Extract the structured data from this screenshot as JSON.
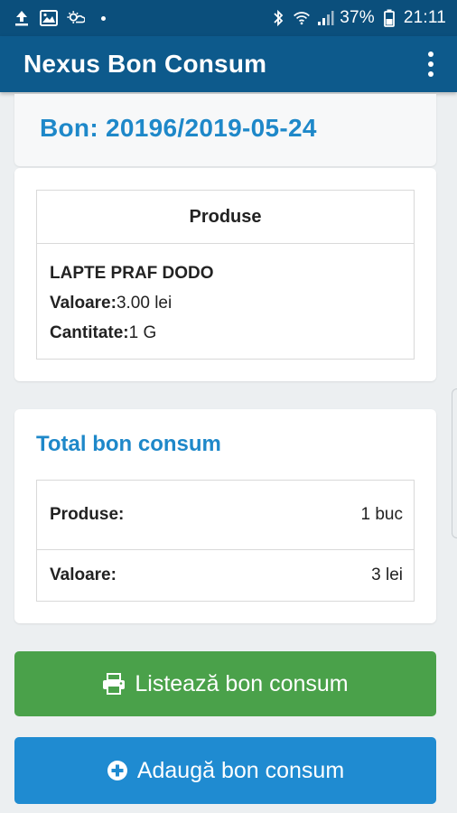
{
  "status_bar": {
    "battery": "37%",
    "time": "21:11"
  },
  "app_bar": {
    "title": "Nexus Bon Consum"
  },
  "receipt": {
    "title": "Bon: 20196/2019-05-24"
  },
  "products_table": {
    "header": "Produse",
    "items": [
      {
        "name": "LAPTE PRAF DODO",
        "value_label": "Valoare:",
        "value": "3.00 lei",
        "quantity_label": "Cantitate:",
        "quantity": "1 G"
      }
    ]
  },
  "total": {
    "title": "Total bon consum",
    "rows": [
      {
        "label": "Produse:",
        "value": "1 buc"
      },
      {
        "label": "Valoare:",
        "value": "3 lei"
      }
    ]
  },
  "actions": {
    "print_label": "Listează bon consum",
    "print_icon": "printer-icon",
    "add_label": "Adaugă bon consum",
    "add_icon": "plus-circle-icon"
  },
  "colors": {
    "status_bar": "#0b4f7c",
    "app_bar": "#0d5a8c",
    "accent_title": "#1e88c9",
    "print_button": "#4aa14a",
    "add_button": "#1f8bd1"
  }
}
